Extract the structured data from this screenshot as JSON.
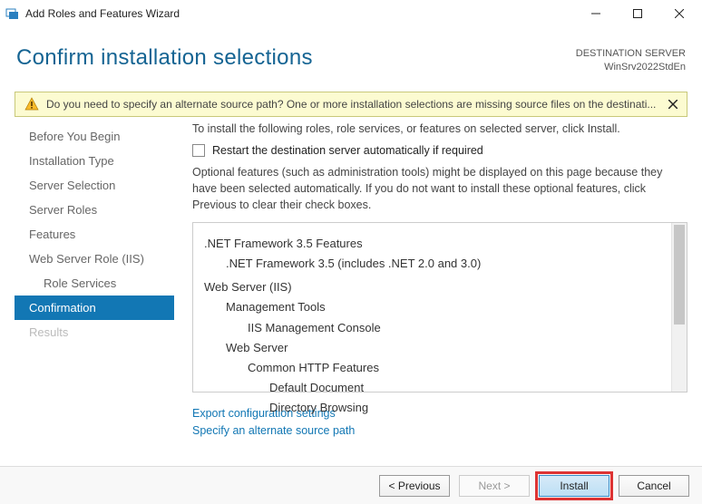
{
  "window": {
    "title": "Add Roles and Features Wizard"
  },
  "header": {
    "title": "Confirm installation selections",
    "dest_label": "DESTINATION SERVER",
    "dest_server": "WinSrv2022StdEn"
  },
  "banner": {
    "message": "Do you need to specify an alternate source path? One or more installation selections are missing source files on the destinati..."
  },
  "sidebar": {
    "items": [
      {
        "label": "Before You Begin"
      },
      {
        "label": "Installation Type"
      },
      {
        "label": "Server Selection"
      },
      {
        "label": "Server Roles"
      },
      {
        "label": "Features"
      },
      {
        "label": "Web Server Role (IIS)"
      },
      {
        "label": "Role Services",
        "sub": true
      },
      {
        "label": "Confirmation",
        "active": true
      },
      {
        "label": "Results",
        "disabled": true
      }
    ]
  },
  "main": {
    "intro": "To install the following roles, role services, or features on selected server, click Install.",
    "restart_label": "Restart the destination server automatically if required",
    "optional_text": "Optional features (such as administration tools) might be displayed on this page because they have been selected automatically. If you do not want to install these optional features, click Previous to clear their check boxes.",
    "selections": {
      "g1": ".NET Framework 3.5 Features",
      "g1a": ".NET Framework 3.5 (includes .NET 2.0 and 3.0)",
      "g2": "Web Server (IIS)",
      "g2a": "Management Tools",
      "g2a1": "IIS Management Console",
      "g2b": "Web Server",
      "g2b1": "Common HTTP Features",
      "g2b1a": "Default Document",
      "g2b1b": "Directory Browsing"
    },
    "link_export": "Export configuration settings",
    "link_path": "Specify an alternate source path"
  },
  "footer": {
    "previous": "< Previous",
    "next": "Next >",
    "install": "Install",
    "cancel": "Cancel"
  }
}
